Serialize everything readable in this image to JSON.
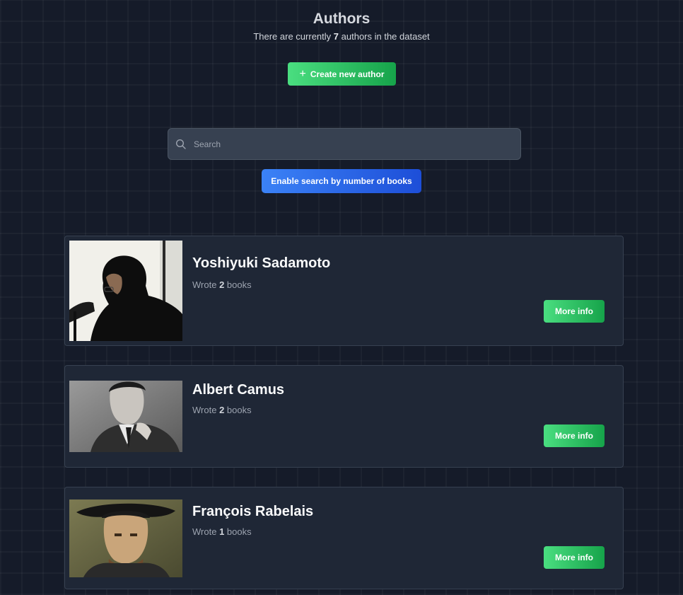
{
  "header": {
    "title": "Authors",
    "subtitle_prefix": "There are currently",
    "author_count": "7",
    "subtitle_suffix": "authors in the dataset"
  },
  "create_button": {
    "icon": "plus-icon",
    "label": "Create new author"
  },
  "search": {
    "icon": "search-icon",
    "placeholder": "Search",
    "value": ""
  },
  "toggle_button": {
    "label": "Enable search by number of books"
  },
  "authors": [
    {
      "name": "Yoshiyuki Sadamoto",
      "books_prefix": "Wrote",
      "books_count": "2",
      "books_suffix": "books",
      "more_label": "More info"
    },
    {
      "name": "Albert Camus",
      "books_prefix": "Wrote",
      "books_count": "2",
      "books_suffix": "books",
      "more_label": "More info"
    },
    {
      "name": "François Rabelais",
      "books_prefix": "Wrote",
      "books_count": "1",
      "books_suffix": "books",
      "more_label": "More info"
    }
  ],
  "colors": {
    "background": "#151b29",
    "card": "#1f2736",
    "green_accent": "#22c55e",
    "blue_accent": "#2563eb"
  }
}
